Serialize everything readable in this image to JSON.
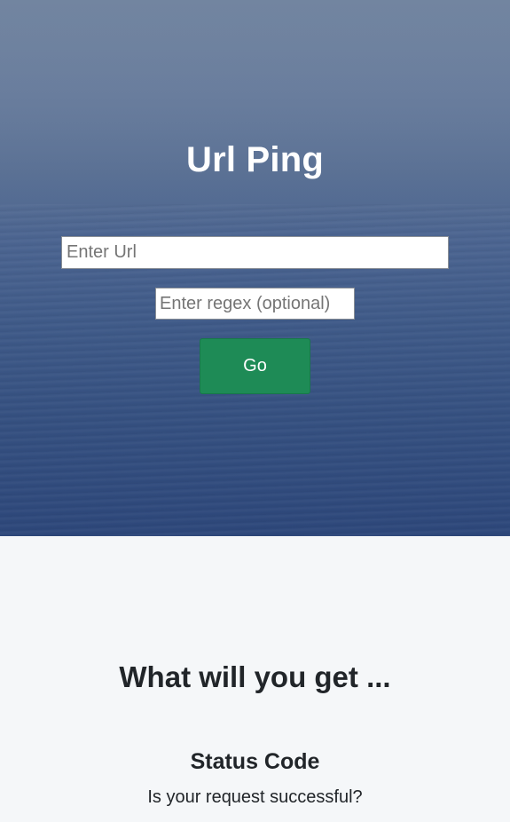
{
  "hero": {
    "title": "Url Ping",
    "url_placeholder": "Enter Url",
    "regex_placeholder": "Enter regex (optional)",
    "go_label": "Go"
  },
  "features": {
    "heading": "What will you get ...",
    "items": [
      {
        "title": "Status Code",
        "description": "Is your request successful?"
      }
    ]
  },
  "colors": {
    "go_button": "#1e8b56",
    "section_background": "#f5f7f9",
    "text": "#212529"
  }
}
